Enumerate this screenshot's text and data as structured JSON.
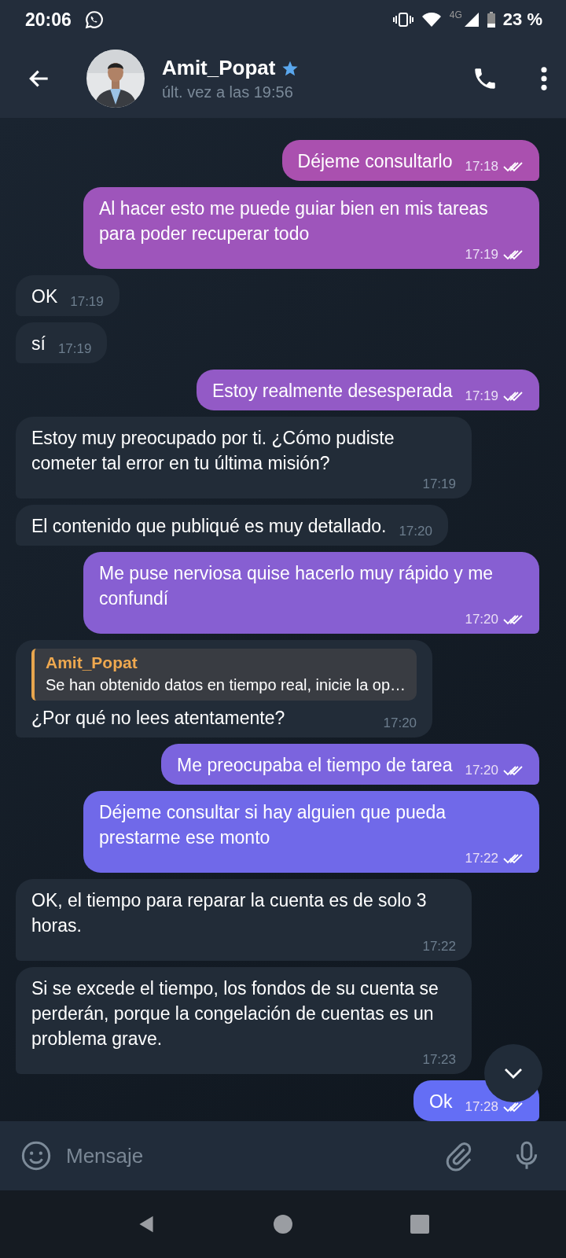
{
  "status_bar": {
    "time": "20:06",
    "network": "4G",
    "battery": "23 %"
  },
  "header": {
    "name": "Amit_Popat",
    "starred": true,
    "last_seen": "últ. vez a las 19:56"
  },
  "messages": [
    {
      "kind": "out",
      "text": "Déjeme consultarlo",
      "time": "17:18",
      "read": true
    },
    {
      "kind": "out",
      "text": "Al hacer esto me puede guiar bien en mis tareas para poder recuperar todo",
      "time": "17:19",
      "read": true
    },
    {
      "kind": "in",
      "text": "OK",
      "time": "17:19"
    },
    {
      "kind": "in",
      "text": "sí",
      "time": "17:19"
    },
    {
      "kind": "out",
      "text": "Estoy realmente desesperada",
      "time": "17:19",
      "read": true
    },
    {
      "kind": "in",
      "text": "Estoy muy preocupado por ti. ¿Cómo pudiste cometer tal error en tu última misión?",
      "time": "17:19"
    },
    {
      "kind": "in",
      "text": "El contenido que publiqué es muy detallado.",
      "time": "17:20"
    },
    {
      "kind": "out",
      "text": "Me puse nerviosa quise hacerlo muy rápido y me confundí",
      "time": "17:20",
      "read": true
    },
    {
      "kind": "in",
      "text": "¿Por qué no lees atentamente?",
      "time": "17:20",
      "reply": {
        "author": "Amit_Popat",
        "text": "Se han obtenido datos en tiempo real, inicie la op…"
      }
    },
    {
      "kind": "out",
      "text": "Me preocupaba el tiempo de tarea",
      "time": "17:20",
      "read": true
    },
    {
      "kind": "out",
      "text": "Déjeme consultar si hay alguien que pueda prestarme ese monto",
      "time": "17:22",
      "read": true
    },
    {
      "kind": "in",
      "text": "OK, el tiempo para reparar la cuenta es de solo 3 horas.",
      "time": "17:22"
    },
    {
      "kind": "in",
      "text": "Si se excede el tiempo, los fondos de su cuenta se perderán, porque la congelación de cuentas es un problema grave.",
      "time": "17:23"
    },
    {
      "kind": "out",
      "text": "Ok",
      "time": "17:28",
      "read": true
    }
  ],
  "composer": {
    "placeholder": "Mensaje"
  }
}
